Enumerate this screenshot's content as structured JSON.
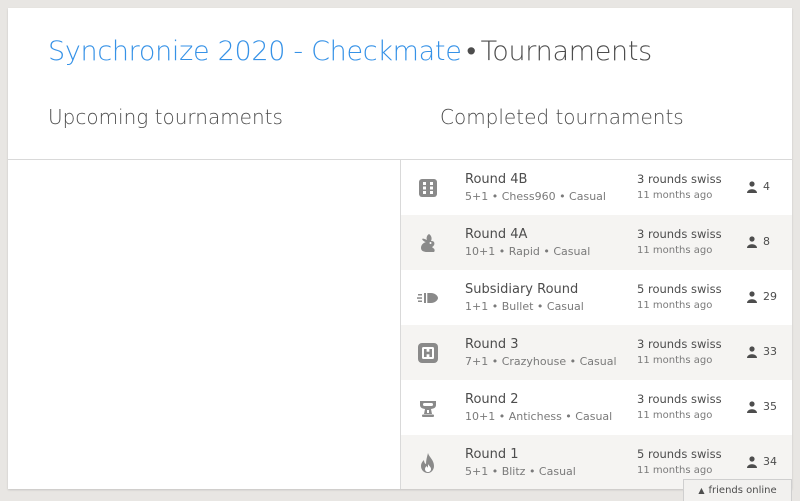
{
  "header": {
    "team_name": "Synchronize 2020 - Checkmate",
    "separator": "•",
    "section": "Tournaments"
  },
  "columns": {
    "upcoming_title": "Upcoming tournaments",
    "completed_title": "Completed tournaments"
  },
  "completed": [
    {
      "icon": "chess960-dice-icon",
      "name": "Round 4B",
      "meta": "5+1 • Chess960 • Casual",
      "format": "3 rounds swiss",
      "ago": "11 months ago",
      "players": "4"
    },
    {
      "icon": "rapid-rabbit-icon",
      "name": "Round 4A",
      "meta": "10+1 • Rapid • Casual",
      "format": "3 rounds swiss",
      "ago": "11 months ago",
      "players": "8"
    },
    {
      "icon": "bullet-icon",
      "name": "Subsidiary Round",
      "meta": "1+1 • Bullet • Casual",
      "format": "5 rounds swiss",
      "ago": "11 months ago",
      "players": "29"
    },
    {
      "icon": "crazyhouse-icon",
      "name": "Round 3",
      "meta": "7+1 • Crazyhouse • Casual",
      "format": "3 rounds swiss",
      "ago": "11 months ago",
      "players": "33"
    },
    {
      "icon": "antichess-icon",
      "name": "Round 2",
      "meta": "10+1 • Antichess • Casual",
      "format": "3 rounds swiss",
      "ago": "11 months ago",
      "players": "35"
    },
    {
      "icon": "blitz-flame-icon",
      "name": "Round 1",
      "meta": "5+1 • Blitz • Casual",
      "format": "5 rounds swiss",
      "ago": "11 months ago",
      "players": "34"
    }
  ],
  "friends_bar": {
    "label": "friends online",
    "arrow": "▲"
  }
}
